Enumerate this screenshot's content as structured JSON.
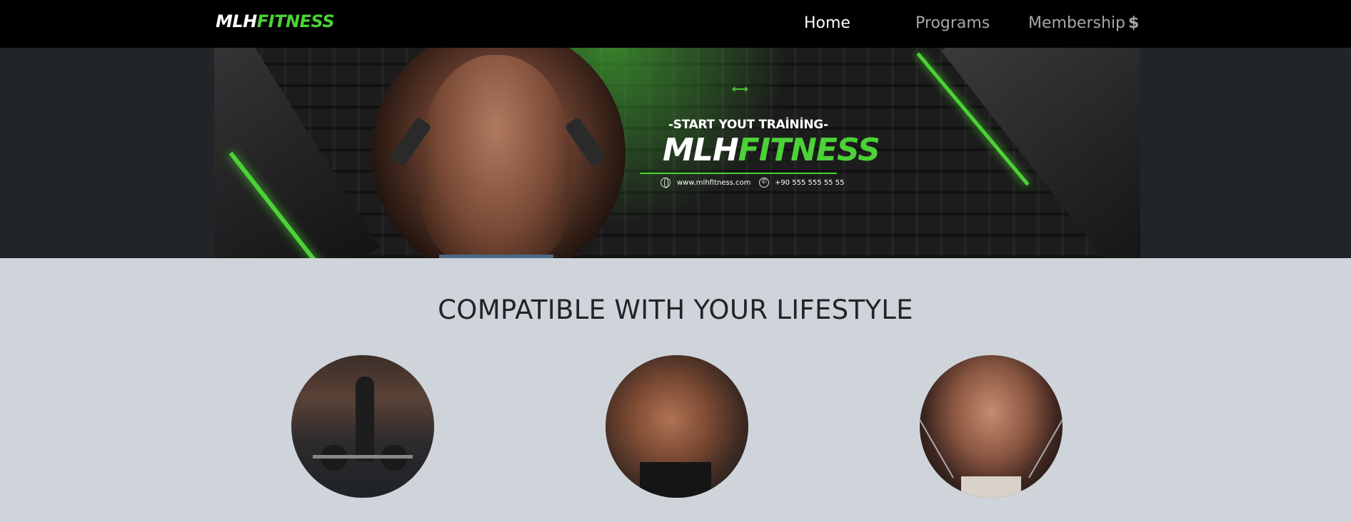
{
  "nav": {
    "logo_part1": "MLH",
    "logo_part2": "FITNESS",
    "items": [
      {
        "label": "Home"
      },
      {
        "label": "Programs"
      },
      {
        "label": "Membership"
      }
    ],
    "membership_icon": "$"
  },
  "banner": {
    "icon": "dumbbell-icon",
    "tagline": "-START YOUT TRAİNİNG-",
    "brand_part1": "MLH",
    "brand_part2": "FITNESS",
    "website": "www.mlhfitness.com",
    "phone": "+90 555 555 55 55"
  },
  "lifestyle": {
    "title": "COMPATIBLE WITH YOUR LIFESTYLE"
  },
  "colors": {
    "accent": "#4cd137",
    "nav_bg": "#000000",
    "hero_bg": "#212529",
    "section_bg": "#cfd4da"
  }
}
